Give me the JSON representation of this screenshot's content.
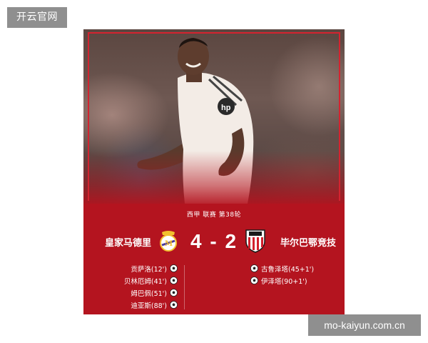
{
  "watermark": {
    "top": "开云官网",
    "bottom": "mo-kaiyun.com.cn"
  },
  "match": {
    "info": "西甲 联赛 第38轮",
    "home_team": "皇家马德里",
    "away_team": "毕尔巴鄂竞技",
    "score": "4 - 2",
    "home_scorers": [
      "贡萨洛(12')",
      "贝林厄姆(41')",
      "姆巴佩(51')",
      "迪亚斯(88')"
    ],
    "away_scorers": [
      "古鲁泽塔(45+1')",
      "伊泽塔(90+1')"
    ]
  },
  "colors": {
    "card_red": "#b4141f",
    "frame_red": "#d4232f",
    "watermark_gray": "#8f8f8f"
  },
  "icons": {
    "home_crest": "real-madrid-crest",
    "away_crest": "athletic-bilbao-crest",
    "goal": "football-icon"
  }
}
